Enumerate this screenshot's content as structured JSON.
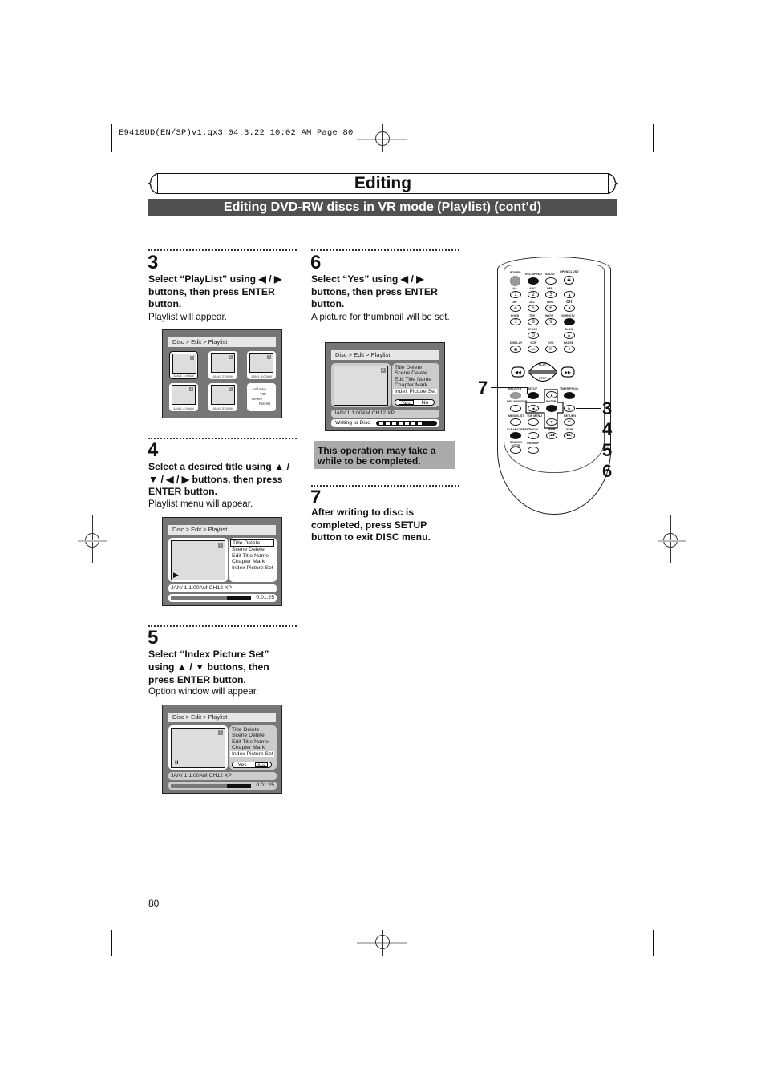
{
  "slug": "E9410UD(EN/SP)v1.qx3   04.3.22   10:02 AM   Page 80",
  "header": {
    "title": "Editing",
    "subtitle": "Editing DVD-RW discs in VR mode (Playlist) (cont’d)"
  },
  "steps": [
    {
      "number": "3",
      "instruction": "Select “PlayList” using ◀ / ▶ buttons, then press ENTER button.",
      "result": "Playlist will appear."
    },
    {
      "number": "4",
      "instruction": "Select a desired title using ▲ / ▼ / ◀ / ▶ buttons, then press ENTER button.",
      "result": "Playlist menu will appear."
    },
    {
      "number": "5",
      "instruction": "Select “Index Picture Set” using ▲ / ▼ buttons, then press ENTER button.",
      "result": "Option window will appear."
    },
    {
      "number": "6",
      "instruction": "Select “Yes” using ◀ / ▶ buttons, then press ENTER button.",
      "result": "A picture for thumbnail will be set."
    },
    {
      "number": "7",
      "instruction": "After writing to disc is completed, press SETUP button to exit DISC menu.",
      "result": ""
    }
  ],
  "note": "This operation may take a while to be completed.",
  "osd": {
    "breadcrumb": "Disc > Edit > Playlist",
    "thumbnails": [
      {
        "num": "1",
        "date": "JAN/1  1:00AM"
      },
      {
        "num": "2",
        "date": "JAN/1  2:00AM"
      },
      {
        "num": "3",
        "date": "JAN/1  3:00AM"
      },
      {
        "num": "4",
        "date": "JAN/1  4:00AM"
      },
      {
        "num": "5",
        "date": "JAN/1  5:00AM"
      }
    ],
    "playlist_menu": [
      "Add New",
      "Title",
      "Delete",
      "Playlist"
    ],
    "menu_items": [
      "Title Delete",
      "Scene Delete",
      "Edit Title Name",
      "Chapter Mark",
      "Index Picture Set"
    ],
    "thumb_num": "1",
    "info": "JAN/ 1   1:00AM  CH12     XP",
    "time": "0:01:25",
    "progress": 0.7,
    "yes": "Yes",
    "no": "No",
    "writing": "Writing to Disc",
    "play_icon": "▶",
    "pause_icon": "II"
  },
  "remote": {
    "labels": {
      "power": "POWER",
      "rec_speed": "REC SPEED",
      "audio": "AUDIO",
      "open_close": "OPEN/CLOSE",
      "k1": ".@/:",
      "k2": "ABC",
      "k3": "DEF",
      "k4": "GHI",
      "k5": "JKL",
      "k6": "MNO",
      "ch": "CH",
      "k7": "PQRS",
      "k8": "TUV",
      "k9": "WXYZ",
      "video_tv": "VIDEO/TV",
      "space": "SPACE",
      "slow": "SLOW",
      "display": "DISPLAY",
      "vcr": "VCR",
      "dvd": "DVD",
      "pause": "PAUSE",
      "play": "PLAY",
      "stop": "STOP",
      "rec_otr": "REC/OTR",
      "setup": "SETUP",
      "timer_prog": "TIMER PROG.",
      "rec_monitor": "REC MONITOR",
      "enter": "ENTER",
      "menu_list": "MENU/LIST",
      "top_menu": "TOP MENU",
      "return": "RETURN",
      "clear_reset": "CLEAR/C-RESET",
      "zoom": "ZOOM",
      "skip_back": "SKIP",
      "skip_fwd": "SKIP",
      "search_mode": "SEARCH MODE",
      "cm_skip": "CM SKIP"
    },
    "digits": [
      "1",
      "2",
      "3",
      "4",
      "5",
      "6",
      "7",
      "8",
      "9",
      "0"
    ],
    "callouts": {
      "left": "7",
      "right": [
        "3",
        "4",
        "5",
        "6"
      ]
    }
  },
  "page_number": "80"
}
